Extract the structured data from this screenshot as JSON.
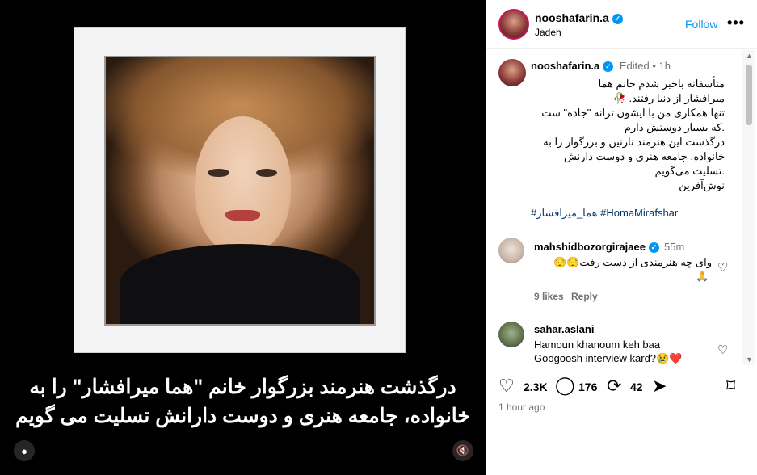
{
  "media": {
    "caption_line1": "درگذشت هنرمند بزرگوار خانم \"هما میرافشار\" را به",
    "caption_line2": "خانواده، جامعه هنری و دوست دارانش تسلیت می گویم"
  },
  "header": {
    "username": "nooshafarin.a",
    "subtitle": "Jadeh",
    "follow_label": "Follow",
    "more_label": "•••"
  },
  "post": {
    "username": "nooshafarin.a",
    "edited": "Edited",
    "dot": "•",
    "time": "1h",
    "lines": [
      "متأسفانه باخبر شدم خانم هما",
      "میرافشار از دنیا رفتند. 🥀",
      "تنها همکاری من با ایشون ترانه \"جاده\" ست",
      ".که بسیار دوستش دارم",
      "درگذشت این هنرمند نازنین و بزرگوار را به",
      "خانواده، جامعه هنری و دوست دارنش",
      ".تسلیت می‌گویم",
      "نوش‌آفرین"
    ],
    "hashtags": "#هما_میرافشار #HomaMirafshar"
  },
  "comments": [
    {
      "username": "mahshidbozorgirajaee",
      "time": "55m",
      "text": "وای چه هنرمندی از دست رفت😔😔",
      "emoji": "🙏",
      "likes": "9 likes",
      "reply": "Reply"
    },
    {
      "username": "sahar.aslani",
      "text_line1": "Hamoun khanoum keh baa",
      "text_line2": "Googoosh interview kard?😢❤️"
    }
  ],
  "actions": {
    "likes": "2.3K",
    "comments": "176",
    "reposts": "42",
    "posted_ago": "1 hour ago"
  }
}
